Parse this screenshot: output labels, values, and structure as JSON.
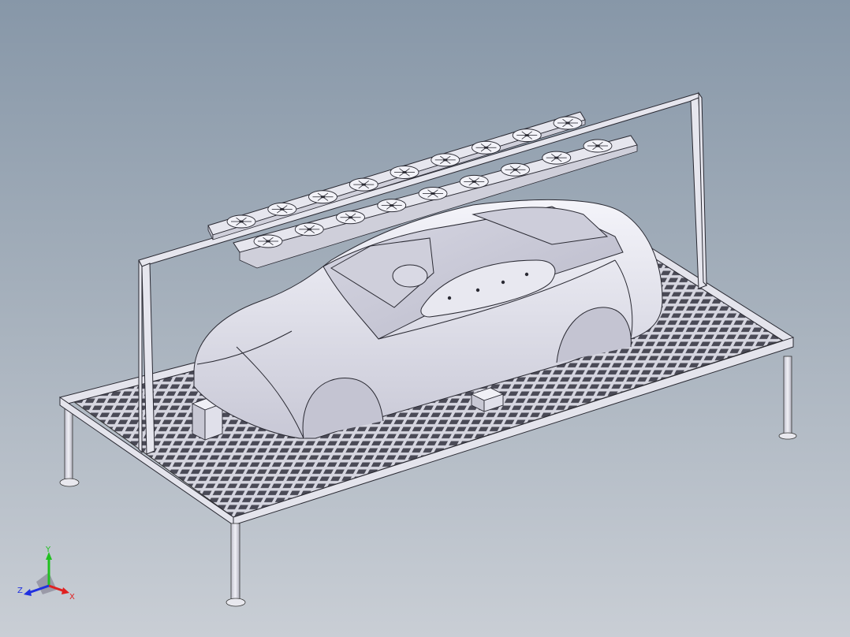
{
  "viewport": {
    "background_top": "#8797a8",
    "background_bottom": "#c9ced5",
    "model_color": "#e3e3ec",
    "edge_color": "#2a2a33"
  },
  "model": {
    "parts": [
      "platform-frame",
      "grating-floor",
      "support-legs",
      "gantry-frame",
      "fan-panel-front",
      "fan-panel-rear",
      "car-body-shell",
      "support-blocks"
    ],
    "fan_panel_front_fans": 9,
    "fan_panel_rear_fans": 9
  },
  "triad": {
    "x_label": "X",
    "y_label": "Y",
    "z_label": "Z",
    "x_color": "#e02020",
    "y_color": "#20c020",
    "z_color": "#2030e0"
  }
}
